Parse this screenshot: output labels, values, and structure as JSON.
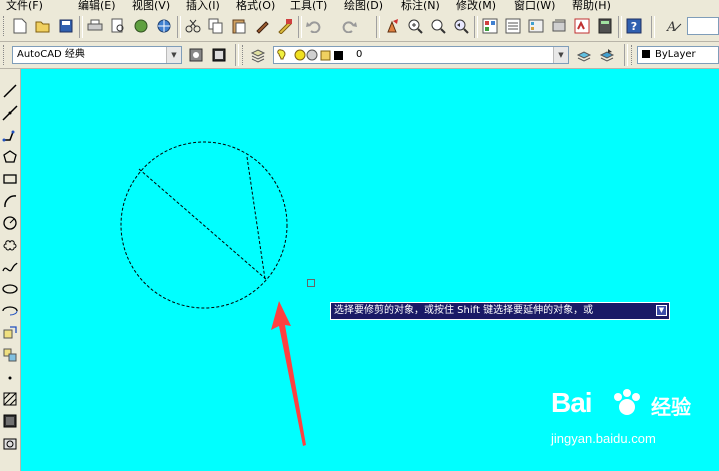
{
  "menu": [
    "文件(F)",
    "编辑(E)",
    "视图(V)",
    "插入(I)",
    "格式(O)",
    "工具(T)",
    "绘图(D)",
    "标注(N)",
    "修改(M)",
    "窗口(W)",
    "帮助(H)"
  ],
  "workspace_combo": {
    "value": "AutoCAD 经典"
  },
  "layer_combo": {
    "value": "0"
  },
  "color_combo": {
    "value": "ByLayer"
  },
  "command_tooltip": {
    "text": "选择要修剪的对象，或按住 Shift 键选择要延伸的对象，或"
  },
  "watermark": {
    "brand": "Bai",
    "brand_cn": "经验",
    "url": "jingyan.baidu.com"
  },
  "colors": {
    "canvas": "#00ffff",
    "tooltip_bg": "#1a1a66",
    "arrow": "#ff4040"
  }
}
